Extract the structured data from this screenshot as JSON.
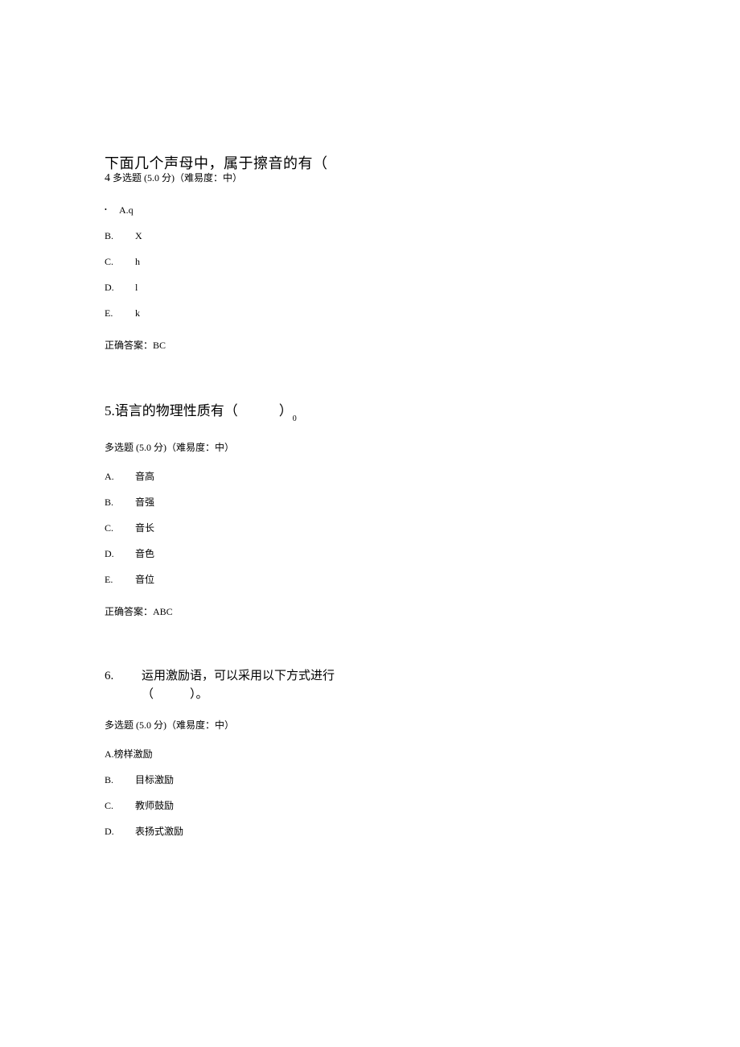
{
  "q4": {
    "title": "下面几个声母中，属于擦音的有（",
    "num": "4",
    "meta": "多选题 (5.0 分)（难易度：中）",
    "optA_bullet": "•",
    "optA": "A.q",
    "optB_letter": "B.",
    "optB_text": "X",
    "optC_letter": "C.",
    "optC_text": "h",
    "optD_letter": "D.",
    "optD_text": "l",
    "optE_letter": "E.",
    "optE_text": "k",
    "answer": "正确答案：BC"
  },
  "q5": {
    "title_pre": "5.语言的物理性质有（",
    "title_post": "）",
    "title_sub": "0",
    "meta": "多选题 (5.0 分)（难易度：中）",
    "optA_letter": "A.",
    "optA_text": "音高",
    "optB_letter": "B.",
    "optB_text": "音强",
    "optC_letter": "C.",
    "optC_text": "音长",
    "optD_letter": "D.",
    "optD_text": "音色",
    "optE_letter": "E.",
    "optE_text": "音位",
    "answer": "正确答案：ABC"
  },
  "q6": {
    "num": "6.",
    "text": "运用激励语，可以采用以下方式进行（　　　）。",
    "meta": "多选题 (5.0 分)（难易度：中）",
    "optA": "A.榜样激励",
    "optB_letter": "B.",
    "optB_text": "目标激励",
    "optC_letter": "C.",
    "optC_text": "教师鼓励",
    "optD_letter": "D.",
    "optD_text": "表扬式激励"
  }
}
